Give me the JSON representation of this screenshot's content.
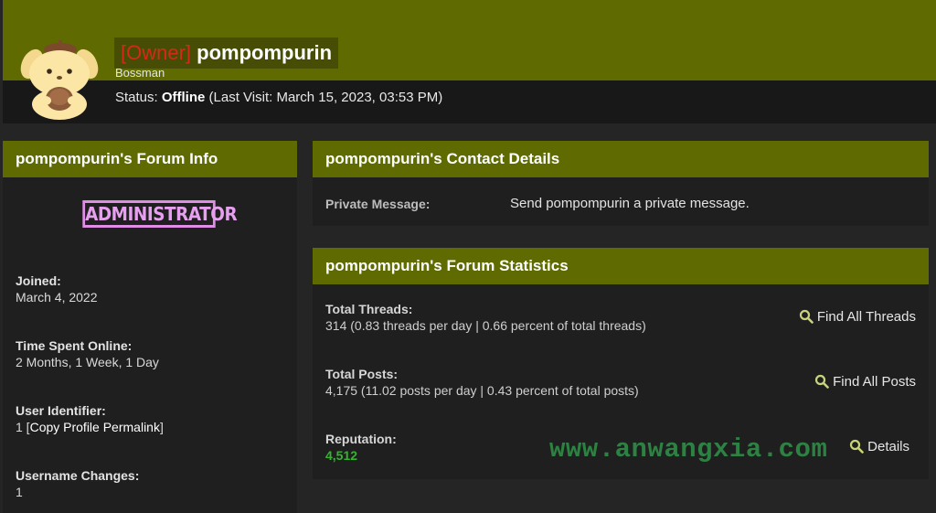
{
  "header": {
    "owner_tag": "[Owner]",
    "username": "pompompurin",
    "user_title": "Bossman",
    "status_prefix": "Status: ",
    "status_value": "Offline",
    "status_suffix": " (Last Visit: March 15, 2023, 03:53 PM)"
  },
  "forum_info": {
    "title": "pompompurin's Forum Info",
    "badge": "ADMINISTRATOR",
    "joined_label": "Joined:",
    "joined_value": "March 4, 2022",
    "time_online_label": "Time Spent Online:",
    "time_online_value": "2 Months, 1 Week, 1 Day",
    "uid_label": "User Identifier:",
    "uid_value": "1",
    "uid_open": " [",
    "uid_link": "Copy Profile Permalink",
    "uid_close": "]",
    "username_changes_label": "Username Changes:",
    "username_changes_value": "1"
  },
  "contact": {
    "title": "pompompurin's Contact Details",
    "pm_label": "Private Message:",
    "pm_value": "Send pompompurin a private message."
  },
  "stats": {
    "title": "pompompurin's Forum Statistics",
    "threads_label": "Total Threads:",
    "threads_value": "314 (0.83 threads per day | 0.66 percent of total threads)",
    "threads_link": "Find All Threads",
    "posts_label": "Total Posts:",
    "posts_value": "4,175 (11.02 posts per day | 0.43 percent of total posts)",
    "posts_link": "Find All Posts",
    "rep_label": "Reputation:",
    "rep_value": "4,512",
    "rep_link": "Details"
  },
  "watermark": "www.anwangxia.com",
  "colors": {
    "header_olive": "#5f6b00",
    "owner_red": "#d42a1a",
    "badge_pink": "#e08de6",
    "reputation_green": "#35b52f"
  },
  "icons": [
    "avatar-pompompurin",
    "search-icon"
  ]
}
